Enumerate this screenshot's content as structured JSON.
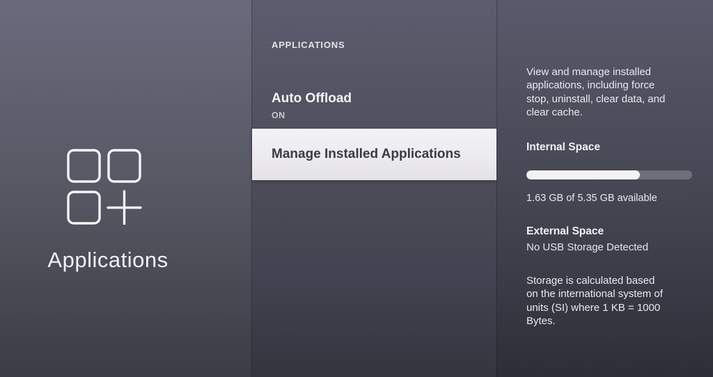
{
  "left_panel": {
    "title": "Applications",
    "icon": "apps-grid-plus-icon"
  },
  "middle_panel": {
    "header": "APPLICATIONS",
    "items": [
      {
        "label": "Auto Offload",
        "value": "ON",
        "selected": false
      },
      {
        "label": "Manage Installed Applications",
        "selected": true
      }
    ]
  },
  "right_panel": {
    "description": "View and manage installed\napplications, including force\nstop, uninstall, clear data, and\nclear cache.",
    "internal_space": {
      "label": "Internal Space",
      "used_percent": 68.5,
      "available_text": "1.63 GB of 5.35 GB available"
    },
    "external_space": {
      "label": "External Space",
      "status": "No USB Storage Detected"
    },
    "storage_note": "Storage is calculated based\non the international system of\nunits (SI) where 1 KB = 1000\nBytes."
  },
  "colors": {
    "selected_row_bg": "#eceaee",
    "selected_row_text": "#3b3b45",
    "progress_track": "#6d6f79",
    "progress_fill": "#f2f2f6",
    "panel_text": "#e9e9ec"
  }
}
